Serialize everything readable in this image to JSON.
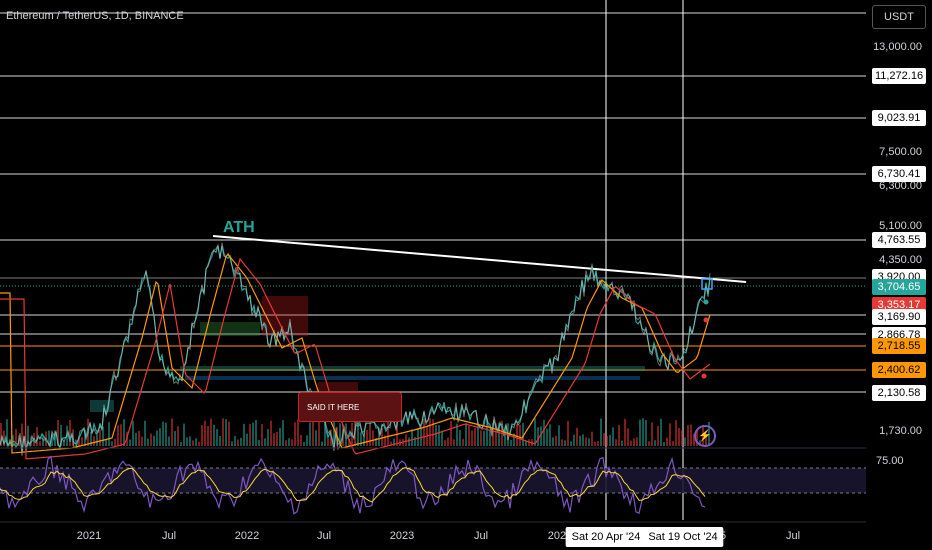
{
  "symbol_title": "Ethereum / TetherUS, 1D, BINANCE",
  "currency": "USDT",
  "annotations": {
    "ath": "ATH",
    "said_it_here": "SAID IT HERE",
    "bolt_icon": "lightning-icon"
  },
  "price_axis": {
    "labels": [
      "13,000.00",
      "7,500.00",
      "6,300.00",
      "5,100.00",
      "4,350.00",
      "1,730.00"
    ],
    "tags": [
      {
        "text": "11,272.16",
        "bg": "#ffffff",
        "fg": "#000000"
      },
      {
        "text": "9,023.91",
        "bg": "#ffffff",
        "fg": "#000000"
      },
      {
        "text": "6,730.41",
        "bg": "#ffffff",
        "fg": "#000000"
      },
      {
        "text": "4,763.55",
        "bg": "#ffffff",
        "fg": "#000000"
      },
      {
        "text": "3,920.00",
        "bg": "#ffffff",
        "fg": "#000000"
      },
      {
        "text": "3,704.65",
        "bg": "#26a69a",
        "fg": "#ffffff"
      },
      {
        "text": "3,353.17",
        "bg": "#e53935",
        "fg": "#ffffff"
      },
      {
        "text": "3,169.90",
        "bg": "#ffffff",
        "fg": "#000000"
      },
      {
        "text": "2,866.78",
        "bg": "#ffffff",
        "fg": "#000000"
      },
      {
        "text": "2,718.55",
        "bg": "#ff9800",
        "fg": "#000000"
      },
      {
        "text": "2,400.62",
        "bg": "#ff9800",
        "fg": "#000000"
      },
      {
        "text": "2,130.58",
        "bg": "#ffffff",
        "fg": "#000000"
      }
    ]
  },
  "rsi_axis": {
    "label": "75.00"
  },
  "time_axis": {
    "labels": [
      "2021",
      "Jul",
      "2022",
      "Jul",
      "2023",
      "Jul",
      "2024",
      "5",
      "Jul"
    ],
    "crosshair_dates": [
      "Sat 20 Apr '24",
      "Sat 19 Oct '24"
    ]
  },
  "colors": {
    "background": "#000000",
    "up": "#26a69a",
    "down": "#e53935",
    "rsi": "#7e57c2",
    "accent": "#ff9800"
  }
}
